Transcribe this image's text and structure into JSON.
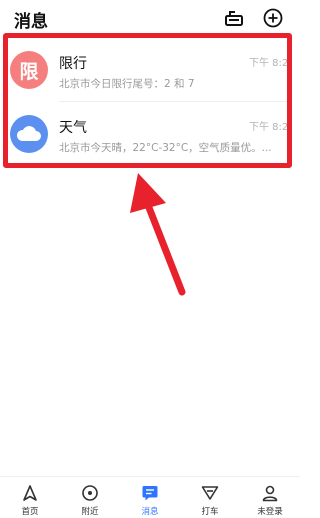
{
  "header": {
    "title": "消息"
  },
  "messages": [
    {
      "name": "限行",
      "avatar_text": "限",
      "avatar_color": "#f57f7f",
      "time": "下午 8:2",
      "preview": "北京市今日限行尾号：2 和 7"
    },
    {
      "name": "天气",
      "avatar_icon": "cloud-icon",
      "avatar_color": "#5b8ff0",
      "time": "下午 8:2",
      "preview": "北京市今天晴，22°C-32°C，空气质量优。..."
    }
  ],
  "tabs": [
    {
      "label": "首页",
      "icon": "navigation-arrow-icon",
      "active": false
    },
    {
      "label": "附近",
      "icon": "location-icon",
      "active": false
    },
    {
      "label": "消息",
      "icon": "message-icon",
      "active": true
    },
    {
      "label": "打车",
      "icon": "taxi-icon",
      "active": false
    },
    {
      "label": "未登录",
      "icon": "user-icon",
      "active": false
    }
  ],
  "colors": {
    "accent": "#2d74ff",
    "annotation_red": "#e8222c"
  }
}
